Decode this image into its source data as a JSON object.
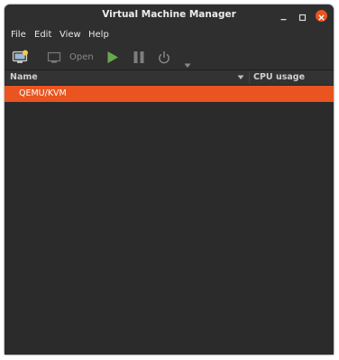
{
  "window": {
    "title": "Virtual Machine Manager"
  },
  "menu": [
    "File",
    "Edit",
    "View",
    "Help"
  ],
  "toolbar": {
    "open_label": "Open"
  },
  "columns": {
    "name": "Name",
    "cpu": "CPU usage"
  },
  "connections": [
    {
      "name": "QEMU/KVM",
      "selected": true
    }
  ],
  "colors": {
    "accent": "#e95420",
    "run_icon": "#6aa84f",
    "bg": "#2b2b2b"
  },
  "icons": [
    "new-vm-icon",
    "monitor-icon",
    "play-icon",
    "pause-icon",
    "power-icon",
    "dropdown-arrow-icon",
    "minimize-icon",
    "maximize-icon",
    "close-icon"
  ]
}
